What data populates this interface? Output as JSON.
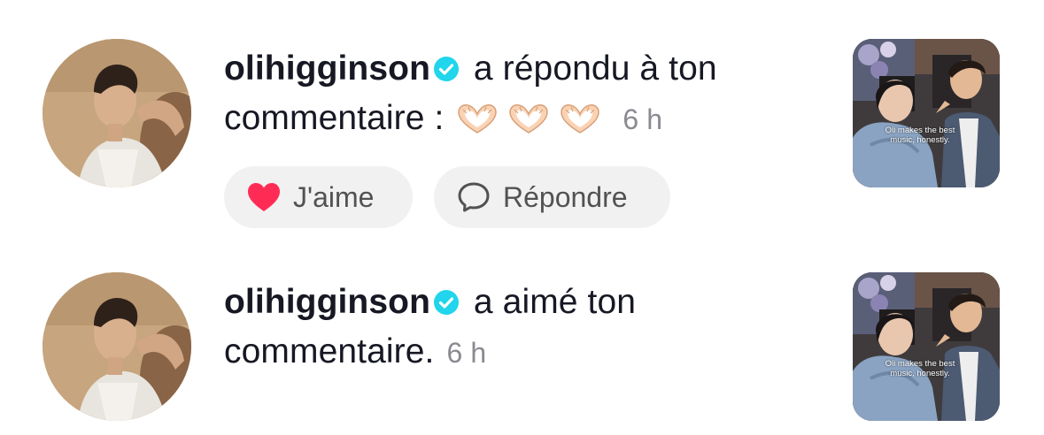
{
  "colors": {
    "verified_badge": "#20d5ec",
    "like_heart": "#fe2c55",
    "time_text": "#8a8b91",
    "pill_bg": "#f1f1f2"
  },
  "notifications": [
    {
      "username": "olihigginson",
      "verified_icon": "verified-check-icon",
      "action": " a répondu à ton",
      "line2_text": "commentaire :",
      "emoji_icons": [
        "heart-hands-emoji",
        "heart-hands-emoji",
        "heart-hands-emoji"
      ],
      "time": "6 h",
      "like_label": "J'aime",
      "reply_label": "Répondre",
      "thumbnail_caption": "Oli makes the best music, honestly."
    },
    {
      "username": "olihigginson",
      "verified_icon": "verified-check-icon",
      "action": " a aimé ton",
      "line2_text": "commentaire.",
      "time": "6 h",
      "thumbnail_caption": "Oli makes the best music, honestly."
    }
  ]
}
